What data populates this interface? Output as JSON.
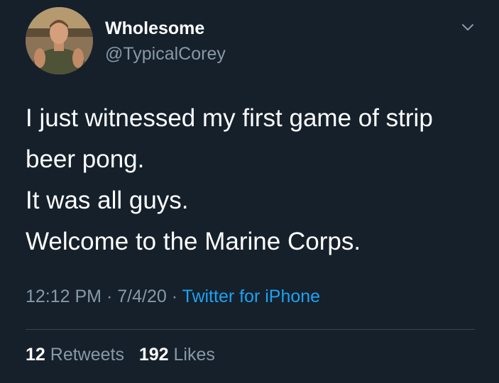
{
  "user": {
    "display_name": "Wholesome",
    "handle": "@TypicalCorey"
  },
  "tweet": {
    "lines": [
      "I just witnessed my first game of strip",
      "beer pong.",
      "It was all guys.",
      "Welcome to the Marine Corps."
    ],
    "time": "12:12 PM",
    "date": "7/4/20",
    "separator": "·",
    "source": "Twitter for iPhone"
  },
  "stats": {
    "retweets_count": "12",
    "retweets_label": "Retweets",
    "likes_count": "192",
    "likes_label": "Likes"
  },
  "icons": {
    "menu": "chevron-down-icon",
    "avatar": "profile-photo"
  },
  "colors": {
    "background": "#15202b",
    "text": "#ffffff",
    "secondary_text": "#8899a6",
    "link": "#1da1f2",
    "divider": "#38444d"
  }
}
